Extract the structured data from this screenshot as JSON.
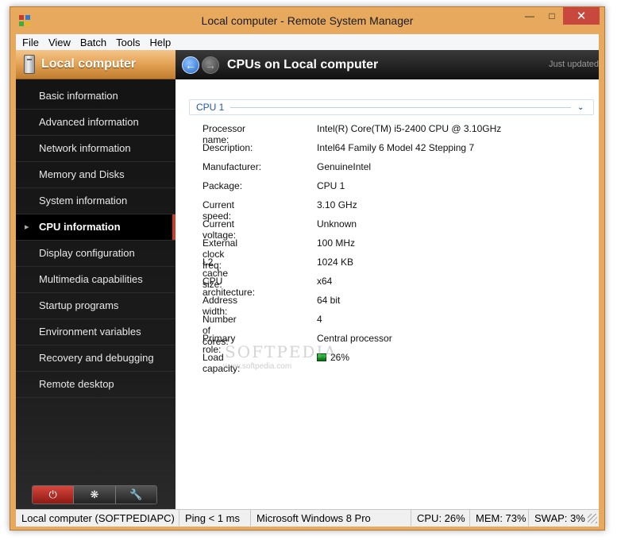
{
  "window": {
    "title": "Local computer - Remote System Manager"
  },
  "menu": [
    "File",
    "View",
    "Batch",
    "Tools",
    "Help"
  ],
  "sidebar": {
    "title": "Local computer",
    "items": [
      {
        "label": "Basic information"
      },
      {
        "label": "Advanced information"
      },
      {
        "label": "Network information"
      },
      {
        "label": "Memory and Disks"
      },
      {
        "label": "System information"
      },
      {
        "label": "CPU information"
      },
      {
        "label": "Display configuration"
      },
      {
        "label": "Multimedia capabilities"
      },
      {
        "label": "Startup programs"
      },
      {
        "label": "Environment variables"
      },
      {
        "label": "Recovery and debugging"
      },
      {
        "label": "Remote desktop"
      }
    ],
    "active_item": "CPU information",
    "tools": [
      "power-icon",
      "spinner-icon",
      "wrench-icon"
    ]
  },
  "content": {
    "title": "CPUs on Local computer",
    "updated": "Just updated",
    "group": {
      "title": "CPU 1"
    },
    "properties": [
      {
        "key": "Processor name:",
        "value": "Intel(R) Core(TM) i5-2400 CPU @ 3.10GHz"
      },
      {
        "key": "Description:",
        "value": "Intel64 Family 6 Model 42 Stepping 7"
      },
      {
        "key": "Manufacturer:",
        "value": "GenuineIntel"
      },
      {
        "key": "Package:",
        "value": "CPU 1"
      },
      {
        "key": "Current speed:",
        "value": "3.10 GHz"
      },
      {
        "key": "Current voltage:",
        "value": "Unknown"
      },
      {
        "key": "External clock freq:",
        "value": "100 MHz"
      },
      {
        "key": "L2 cache size:",
        "value": "1024 KB"
      },
      {
        "key": "CPU architecture:",
        "value": "x64"
      },
      {
        "key": "Address width:",
        "value": "64 bit"
      },
      {
        "key": "Number of cores:",
        "value": "4"
      },
      {
        "key": "Primary role:",
        "value": "Central processor"
      },
      {
        "key": "Load capacity:",
        "value": "26%"
      }
    ]
  },
  "watermark": {
    "main": "SOFTPEDIA",
    "sub": "www.softpedia.com"
  },
  "status": {
    "computer": "Local computer (SOFTPEDIAPC)",
    "ping": "Ping < 1 ms",
    "os": "Microsoft Windows 8 Pro",
    "cpu": "CPU: 26%",
    "mem": "MEM: 73%",
    "swap": "SWAP: 3%"
  },
  "colors": {
    "frame": "#e6a95e",
    "accent": "#d03a2c",
    "link": "#1f5aa3"
  }
}
